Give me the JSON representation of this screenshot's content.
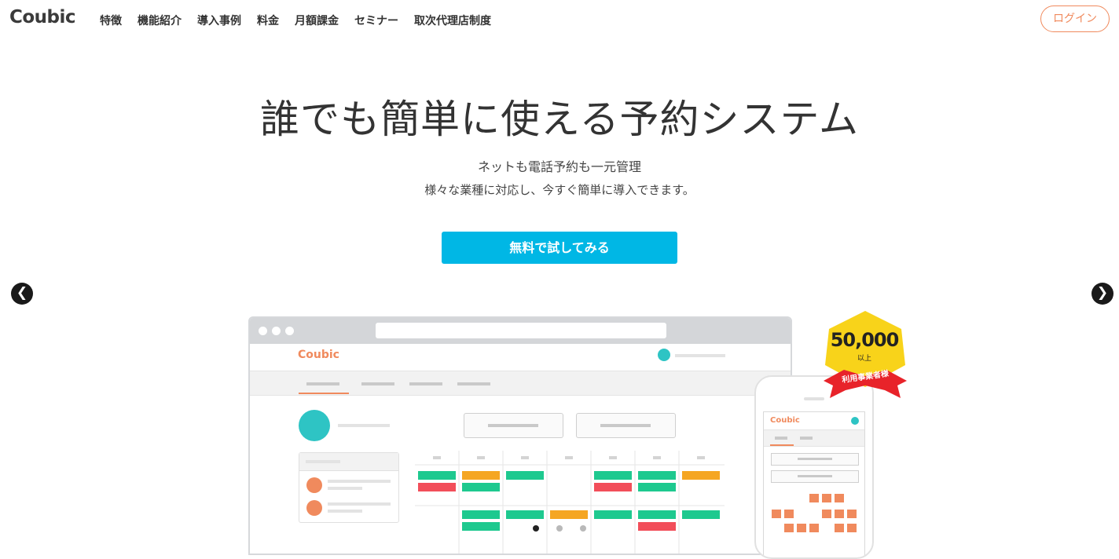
{
  "header": {
    "logo": "Coubic",
    "nav": [
      "特徴",
      "機能紹介",
      "導入事例",
      "料金",
      "月額課金",
      "セミナー",
      "取次代理店制度"
    ],
    "login_label": "ログイン"
  },
  "hero": {
    "title": "誰でも簡単に使える予約システム",
    "subtitle_line1": "ネットも電話予約も一元管理",
    "subtitle_line2": "様々な業種に対応し、今すぐ簡単に導入できます。",
    "cta_label": "無料で試してみる"
  },
  "carousel": {
    "prev_icon": "chevron-left-icon",
    "next_icon": "chevron-right-icon",
    "prev_glyph": "❮",
    "next_glyph": "❯",
    "slide_count": 3,
    "active_slide": 1
  },
  "mockup": {
    "app_logo": "Coubic",
    "phone_logo": "Coubic",
    "badge_number": "50,000",
    "badge_sub": "以上",
    "badge_ribbon": "利用事業者様"
  },
  "colors": {
    "accent": "#00b7e5",
    "brand_orange": "#f08a5d",
    "cal_green": "#1ec98f",
    "cal_orange": "#f5a623",
    "cal_red": "#f24e5a",
    "badge_yellow": "#f8d31a",
    "ribbon_red": "#e8232a"
  }
}
